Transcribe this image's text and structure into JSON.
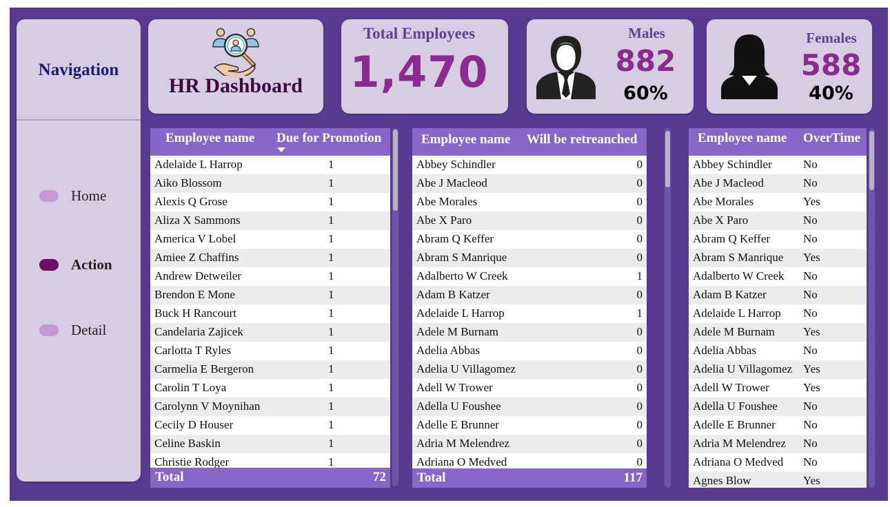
{
  "navigation": {
    "title": "Navigation",
    "items": [
      {
        "label": "Home"
      },
      {
        "label": "Action"
      },
      {
        "label": "Detail"
      }
    ]
  },
  "header": {
    "title": "HR Dashboard",
    "total_label": "Total Employees",
    "total_value": "1,470",
    "males": {
      "label": "Males",
      "value": "882",
      "percent": "60%"
    },
    "females": {
      "label": "Females",
      "value": "588",
      "percent": "40%"
    }
  },
  "colors": {
    "frame": "#573b91",
    "card": "#d6cde3",
    "table_header": "#8766c8",
    "accent_value": "#8b2a8f",
    "active_pill": "#6d0f6b",
    "inactive_pill": "#c59ad3"
  },
  "promotion_table": {
    "col_name": "Employee name",
    "col_value": "Due for Promotion",
    "rows": [
      {
        "name": "Adelaide L Harrop",
        "value": "1"
      },
      {
        "name": "Aiko Blossom",
        "value": "1"
      },
      {
        "name": "Alexis Q Grose",
        "value": "1"
      },
      {
        "name": "Aliza X Sammons",
        "value": "1"
      },
      {
        "name": "America V Lobel",
        "value": "1"
      },
      {
        "name": "Amiee Z Chaffins",
        "value": "1"
      },
      {
        "name": "Andrew Detweiler",
        "value": "1"
      },
      {
        "name": "Brendon E Mone",
        "value": "1"
      },
      {
        "name": "Buck H Rancourt",
        "value": "1"
      },
      {
        "name": "Candelaria Zajicek",
        "value": "1"
      },
      {
        "name": "Carlotta T Ryles",
        "value": "1"
      },
      {
        "name": "Carmelia E Bergeron",
        "value": "1"
      },
      {
        "name": "Carolin T Loya",
        "value": "1"
      },
      {
        "name": "Carolynn V Moynihan",
        "value": "1"
      },
      {
        "name": "Cecily D Houser",
        "value": "1"
      },
      {
        "name": "Celine Baskin",
        "value": "1"
      },
      {
        "name": "Christie Rodger",
        "value": "1"
      }
    ],
    "total_label": "Total",
    "total_value": "72"
  },
  "retrench_table": {
    "col_name": "Employee name",
    "col_value": "Will be retreanched",
    "rows": [
      {
        "name": "Abbey Schindler",
        "value": "0"
      },
      {
        "name": "Abe J Macleod",
        "value": "0"
      },
      {
        "name": "Abe Morales",
        "value": "0"
      },
      {
        "name": "Abe X Paro",
        "value": "0"
      },
      {
        "name": "Abram Q Keffer",
        "value": "0"
      },
      {
        "name": "Abram S Manrique",
        "value": "0"
      },
      {
        "name": "Adalberto W Creek",
        "value": "1"
      },
      {
        "name": "Adam B Katzer",
        "value": "0"
      },
      {
        "name": "Adelaide L Harrop",
        "value": "1"
      },
      {
        "name": "Adele M Burnam",
        "value": "0"
      },
      {
        "name": "Adelia Abbas",
        "value": "0"
      },
      {
        "name": "Adelia U Villagomez",
        "value": "0"
      },
      {
        "name": "Adell W Trower",
        "value": "0"
      },
      {
        "name": "Adella U Foushee",
        "value": "0"
      },
      {
        "name": "Adelle E Brunner",
        "value": "0"
      },
      {
        "name": "Adria M Melendrez",
        "value": "0"
      },
      {
        "name": "Adriana O Medved",
        "value": "0"
      }
    ],
    "total_label": "Total",
    "total_value": "117"
  },
  "overtime_table": {
    "col_name": "Employee name",
    "col_value": "OverTime",
    "rows": [
      {
        "name": "Abbey Schindler",
        "value": "No"
      },
      {
        "name": "Abe J Macleod",
        "value": "No"
      },
      {
        "name": "Abe Morales",
        "value": "Yes"
      },
      {
        "name": "Abe X Paro",
        "value": "No"
      },
      {
        "name": "Abram Q Keffer",
        "value": "No"
      },
      {
        "name": "Abram S Manrique",
        "value": "Yes"
      },
      {
        "name": "Adalberto W Creek",
        "value": "No"
      },
      {
        "name": "Adam B Katzer",
        "value": "No"
      },
      {
        "name": "Adelaide L Harrop",
        "value": "No"
      },
      {
        "name": "Adele M Burnam",
        "value": "Yes"
      },
      {
        "name": "Adelia Abbas",
        "value": "No"
      },
      {
        "name": "Adelia U Villagomez",
        "value": "Yes"
      },
      {
        "name": "Adell W Trower",
        "value": "Yes"
      },
      {
        "name": "Adella U Foushee",
        "value": "No"
      },
      {
        "name": "Adelle E Brunner",
        "value": "No"
      },
      {
        "name": "Adria M Melendrez",
        "value": "No"
      },
      {
        "name": "Adriana O Medved",
        "value": "No"
      },
      {
        "name": "Agnes Blow",
        "value": "Yes"
      }
    ]
  }
}
